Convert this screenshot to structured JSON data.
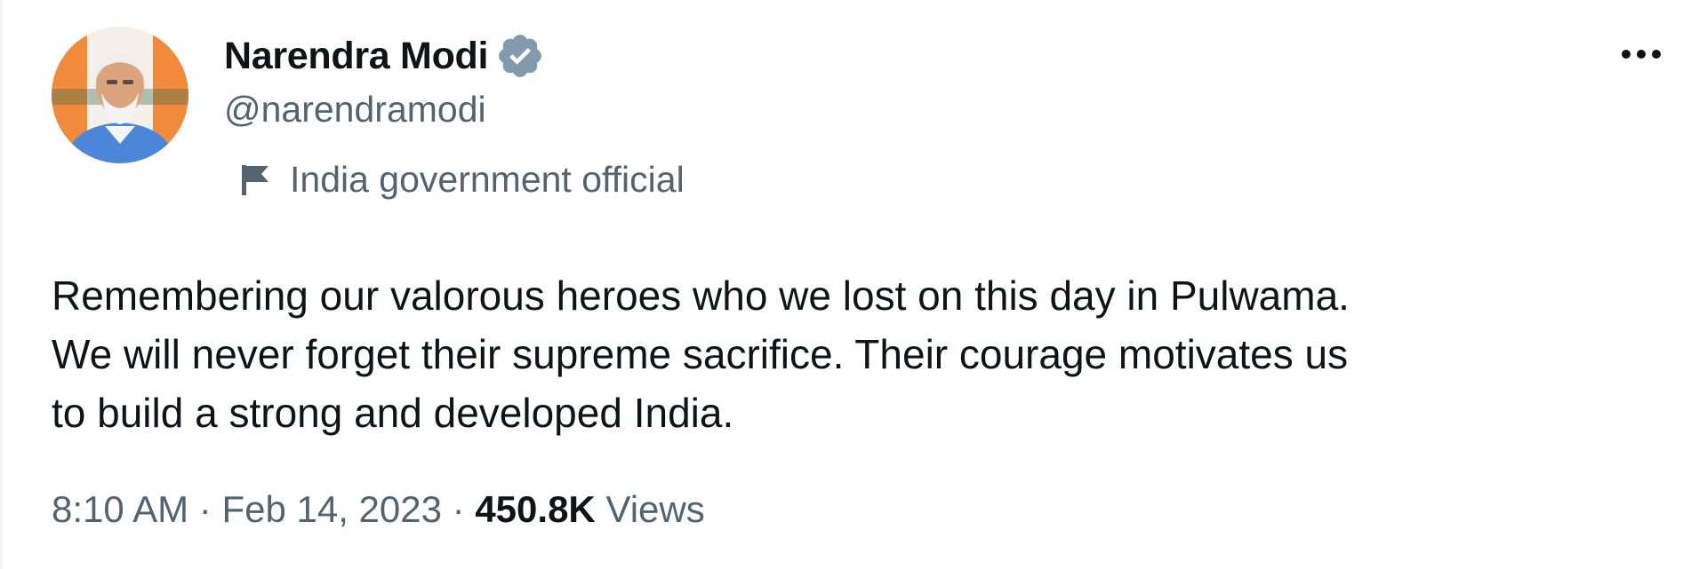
{
  "author": {
    "name": "Narendra Modi",
    "handle": "@narendramodi",
    "verified_icon": "verified-badge-gray",
    "affiliation_icon": "flag-icon",
    "affiliation_label": "India government official"
  },
  "tweet": {
    "text_lines": [
      "Remembering our valorous heroes who we lost on this day in Pulwama.",
      "We will never forget their supreme sacrifice. Their courage motivates us",
      "to build a strong and developed India."
    ],
    "time": "8:10 AM",
    "separator": "·",
    "date": "Feb 14, 2023",
    "views_count": "450.8K",
    "views_label": "Views"
  },
  "icons": {
    "more": "more-horizontal-icon"
  },
  "colors": {
    "primary_text": "#0f1419",
    "secondary_text": "#536471",
    "verified_badge": "#829aab",
    "background": "#ffffff"
  }
}
